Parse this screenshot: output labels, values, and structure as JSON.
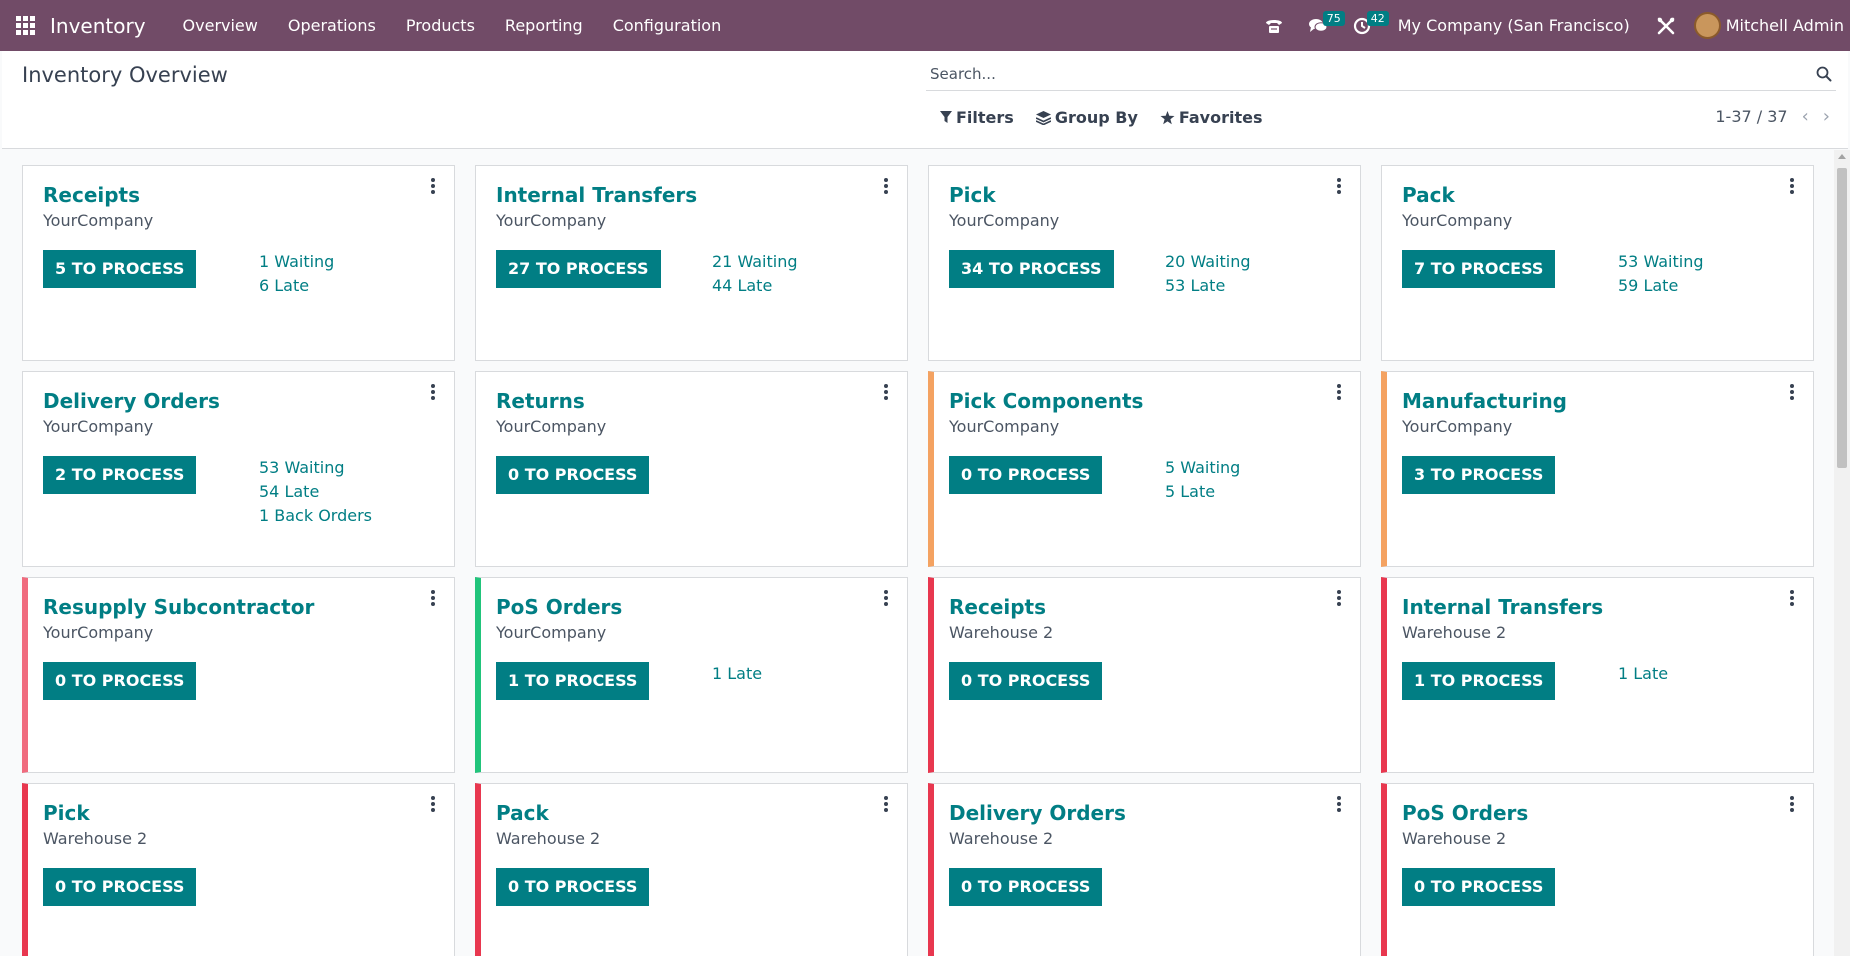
{
  "navbar": {
    "app_name": "Inventory",
    "menu": [
      "Overview",
      "Operations",
      "Products",
      "Reporting",
      "Configuration"
    ],
    "messages_count": "75",
    "activities_count": "42",
    "company": "My Company (San Francisco)",
    "user": "Mitchell Admin",
    "color": "#714b67"
  },
  "control_panel": {
    "title": "Inventory Overview",
    "search_placeholder": "Search...",
    "filters_label": "Filters",
    "group_by_label": "Group By",
    "favorites_label": "Favorites",
    "pager": "1-37 / 37"
  },
  "accent_color": "#017e84",
  "cards": [
    {
      "title": "Receipts",
      "subtitle": "YourCompany",
      "button": "5 TO PROCESS",
      "stats": [
        "1 Waiting",
        "6 Late"
      ],
      "bar": ""
    },
    {
      "title": "Internal Transfers",
      "subtitle": "YourCompany",
      "button": "27 TO PROCESS",
      "stats": [
        "21 Waiting",
        "44 Late"
      ],
      "bar": ""
    },
    {
      "title": "Pick",
      "subtitle": "YourCompany",
      "button": "34 TO PROCESS",
      "stats": [
        "20 Waiting",
        "53 Late"
      ],
      "bar": ""
    },
    {
      "title": "Pack",
      "subtitle": "YourCompany",
      "button": "7 TO PROCESS",
      "stats": [
        "53 Waiting",
        "59 Late"
      ],
      "bar": ""
    },
    {
      "title": "Delivery Orders",
      "subtitle": "YourCompany",
      "button": "2 TO PROCESS",
      "stats": [
        "53 Waiting",
        "54 Late",
        "1 Back Orders"
      ],
      "bar": ""
    },
    {
      "title": "Returns",
      "subtitle": "YourCompany",
      "button": "0 TO PROCESS",
      "stats": [],
      "bar": ""
    },
    {
      "title": "Pick Components",
      "subtitle": "YourCompany",
      "button": "0 TO PROCESS",
      "stats": [
        "5 Waiting",
        "5 Late"
      ],
      "bar": "#f4a261"
    },
    {
      "title": "Manufacturing",
      "subtitle": "YourCompany",
      "button": "3 TO PROCESS",
      "stats": [],
      "bar": "#f4a261"
    },
    {
      "title": "Resupply Subcontractor",
      "subtitle": "YourCompany",
      "button": "0 TO PROCESS",
      "stats": [],
      "bar": "#f06b7e"
    },
    {
      "title": "PoS Orders",
      "subtitle": "YourCompany",
      "button": "1 TO PROCESS",
      "stats": [
        "1 Late"
      ],
      "bar": "#21c47b"
    },
    {
      "title": "Receipts",
      "subtitle": "Warehouse 2",
      "button": "0 TO PROCESS",
      "stats": [],
      "bar": "#e8374f"
    },
    {
      "title": "Internal Transfers",
      "subtitle": "Warehouse 2",
      "button": "1 TO PROCESS",
      "stats": [
        "1 Late"
      ],
      "bar": "#e8374f"
    },
    {
      "title": "Pick",
      "subtitle": "Warehouse 2",
      "button": "0 TO PROCESS",
      "stats": [],
      "bar": "#e8374f"
    },
    {
      "title": "Pack",
      "subtitle": "Warehouse 2",
      "button": "0 TO PROCESS",
      "stats": [],
      "bar": "#e8374f"
    },
    {
      "title": "Delivery Orders",
      "subtitle": "Warehouse 2",
      "button": "0 TO PROCESS",
      "stats": [],
      "bar": "#e8374f"
    },
    {
      "title": "PoS Orders",
      "subtitle": "Warehouse 2",
      "button": "0 TO PROCESS",
      "stats": [],
      "bar": "#e8374f"
    }
  ]
}
